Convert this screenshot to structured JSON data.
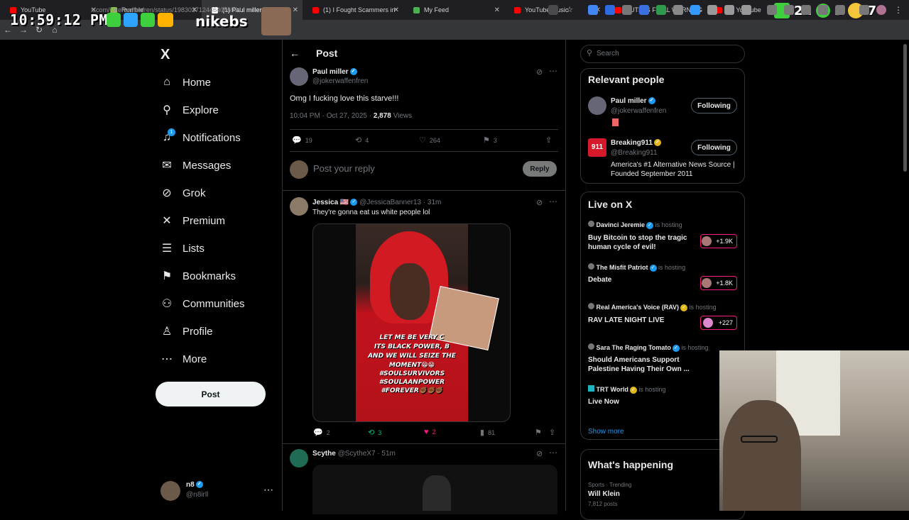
{
  "browser": {
    "tabs": [
      {
        "label": "YouTube",
        "color": "#ff0000"
      },
      {
        "label": "Rumble",
        "color": "#85c742"
      },
      {
        "label": "(1) Paul miller on",
        "color": "#ffffff",
        "active": true
      },
      {
        "label": "(1) I Fought Scammers in",
        "color": "#ff0000"
      },
      {
        "label": "My Feed",
        "color": "#4caf50"
      },
      {
        "label": "YouTube Music",
        "color": "#ff0000"
      },
      {
        "label": "PUTIN'S FINAL WARNING",
        "color": "#ff0000"
      },
      {
        "label": "(1) YouTube",
        "color": "#ff0000"
      }
    ],
    "url": "x.com/jokerwaffenfren/status/1983037124464066964",
    "nav_icons": [
      "back-icon",
      "forward-icon",
      "reload-icon",
      "home-icon"
    ]
  },
  "overlay": {
    "clock": "10:59:12 PM",
    "stream_text": "nikebs",
    "counters": [
      "21",
      "3",
      "7"
    ]
  },
  "sidebar": {
    "logo": "X",
    "items": [
      {
        "label": "Home",
        "icon": "home-icon",
        "glyph": "⌂"
      },
      {
        "label": "Explore",
        "icon": "search-icon",
        "glyph": "⚲"
      },
      {
        "label": "Notifications",
        "icon": "bell-icon",
        "glyph": "♫",
        "badge": "1"
      },
      {
        "label": "Messages",
        "icon": "mail-icon",
        "glyph": "✉"
      },
      {
        "label": "Grok",
        "icon": "grok-icon",
        "glyph": "⊘"
      },
      {
        "label": "Premium",
        "icon": "x-icon",
        "glyph": "✕"
      },
      {
        "label": "Lists",
        "icon": "list-icon",
        "glyph": "☰"
      },
      {
        "label": "Bookmarks",
        "icon": "bookmark-icon",
        "glyph": "⚑"
      },
      {
        "label": "Communities",
        "icon": "people-icon",
        "glyph": "⚇"
      },
      {
        "label": "Profile",
        "icon": "person-icon",
        "glyph": "♙"
      },
      {
        "label": "More",
        "icon": "more-icon",
        "glyph": "⋯"
      }
    ],
    "post_button": "Post",
    "account": {
      "name": "n8",
      "handle": "@n8irll"
    }
  },
  "post": {
    "header": "Post",
    "author": "Paul miller",
    "handle": "@jokerwaffenfren",
    "text": "Omg I fucking love this starve!!!",
    "time": "10:04 PM · Oct 27, 2025 · ",
    "views_count": "2,878",
    "views_label": " Views",
    "replies": "19",
    "reposts": "4",
    "likes": "264",
    "bookmarks": "3",
    "reply_placeholder": "Post your reply",
    "reply_button": "Reply"
  },
  "replies": [
    {
      "author": "Jessica 🇺🇸",
      "handle": "@JessicaBanner13 · 31m",
      "text": "They're gonna eat us white people lol",
      "media_caption": [
        "LET ME BE VERY C",
        "ITS BLACK POWER, B",
        "AND WE WILL SEIZE THE",
        "MOMENT😁😁",
        "#SOULSURVIVORS",
        "#SOULAANPOWER",
        "#FOREVER✊🏾✊🏾✊🏾"
      ],
      "replies": "2",
      "reposts": "3",
      "likes": "2",
      "views": "81"
    },
    {
      "author": "Scythe",
      "handle": "@ScytheX7 · 51m"
    }
  ],
  "right": {
    "search_placeholder": "Search",
    "relevant_title": "Relevant people",
    "people": [
      {
        "name": "Paul miller",
        "handle": "@jokerwaffenfren",
        "button": "Following",
        "bio": ""
      },
      {
        "name": "Breaking911",
        "handle": "@Breaking911",
        "button": "Following",
        "bio": "America's #1 Alternative News Source | Founded September 2011"
      }
    ],
    "live_title": "Live on X",
    "is_hosting": "is hosting",
    "live": [
      {
        "host": "Davinci Jeremie",
        "title": "Buy Bitcoin to stop the tragic human cycle of evil!",
        "count": "+1.9K"
      },
      {
        "host": "The Misfit Patriot",
        "title": "Debate",
        "count": "+1.8K"
      },
      {
        "host": "Real America's Voice (RAV)",
        "title": "RAV LATE NIGHT LIVE",
        "count": "+227"
      },
      {
        "host": "Sara The Raging Tomato",
        "title": "Should Americans Support Palestine Having Their Own ...",
        "count": ""
      },
      {
        "host": "TRT World",
        "title": "Live Now",
        "count": ""
      }
    ],
    "show_more": "Show more",
    "happening_title": "What's happening",
    "trend": {
      "category": "Sports · Trending",
      "name": "Will Klein",
      "posts": "7,812 posts"
    }
  }
}
